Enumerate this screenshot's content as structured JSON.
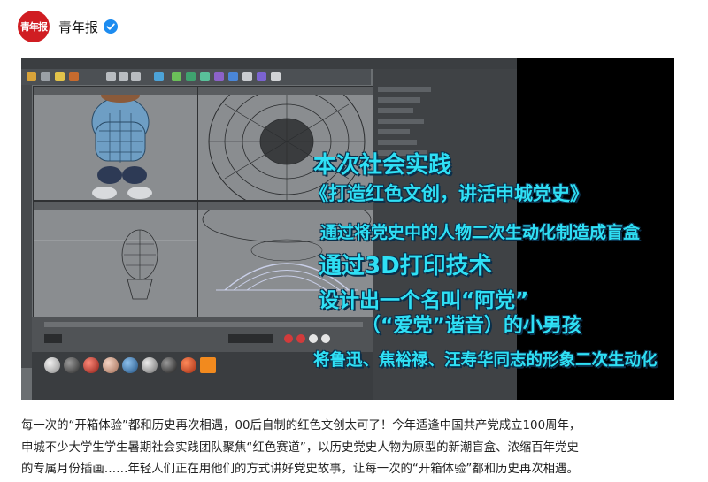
{
  "account": {
    "logo_text": "青年报",
    "name": "青年报"
  },
  "overlay": {
    "lines": [
      "本次社会实践",
      "《打造红色文创，讲活申城党史》",
      "通过将党史中的人物二次生动化制造成盲盒",
      "通过3D打印技术",
      "设计出一个名叫“阿党”",
      "（“爱党”谐音）的小男孩",
      "将鲁迅、焦裕禄、汪寿华同志的形象二次生动化"
    ]
  },
  "caption": {
    "lines": [
      "每一次的“开箱体验”都和历史再次相遇，00后自制的红色文创太可了！今年适逢中国共产党成立100周年，",
      "申城不少大学生学生暑期社会实践团队聚焦“红色赛道”，以历史党史人物为原型的新潮盲盒、浓缩百年党史",
      "的专属月份插画……年轻人们正在用他们的方式讲好党史故事，让每一次的“开箱体验”都和历史再次相遇。"
    ]
  },
  "colors": {
    "brand_red": "#d01d22",
    "verified_blue": "#1d8cf0",
    "overlay_text": "#2fe0f5"
  }
}
